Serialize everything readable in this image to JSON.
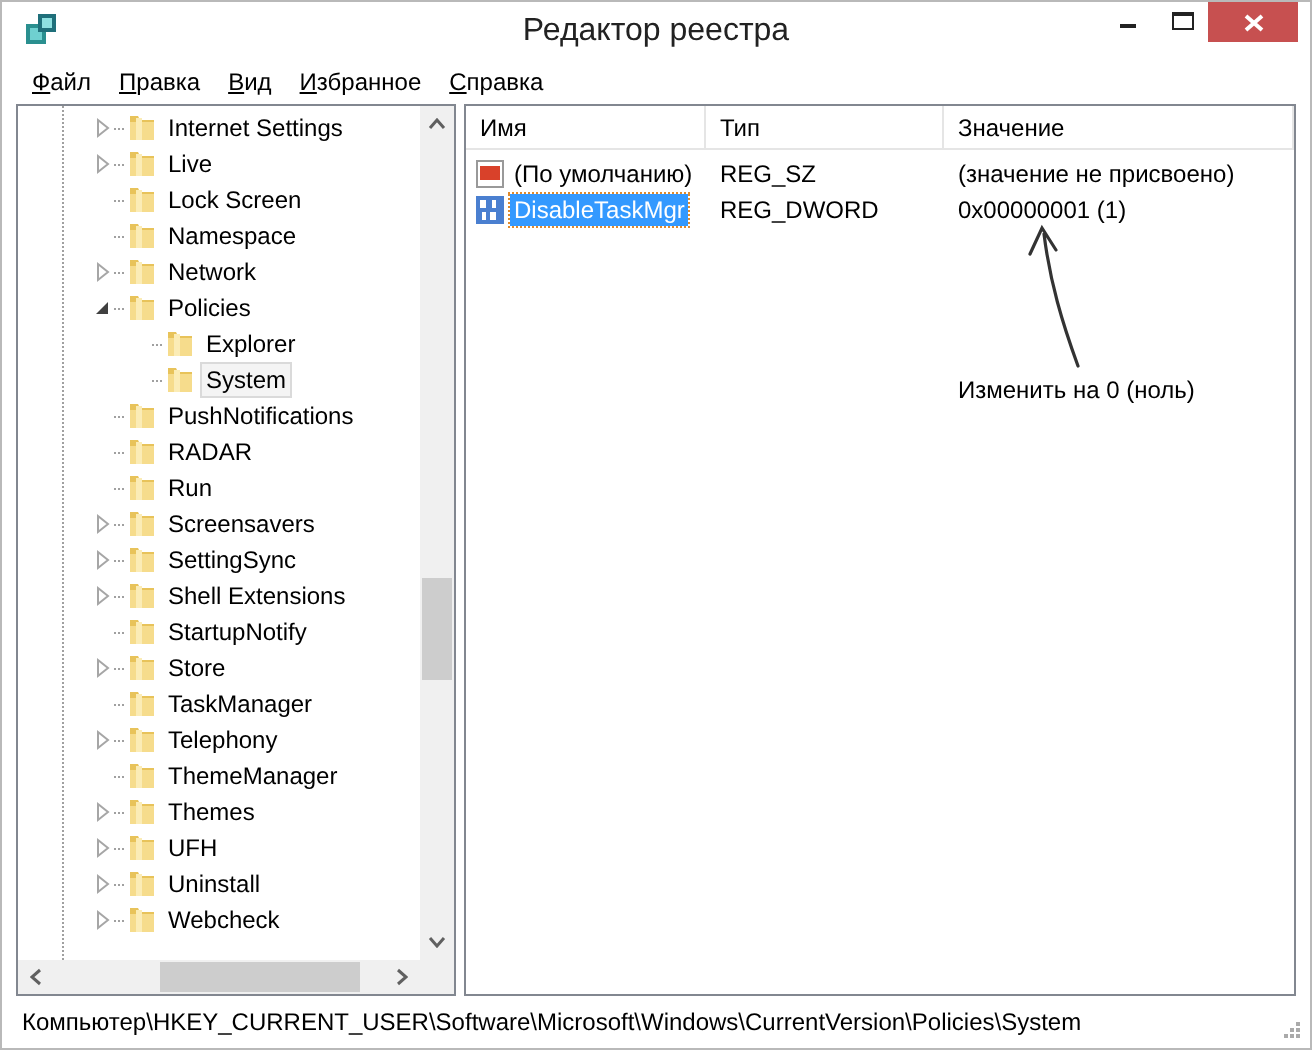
{
  "window": {
    "title": "Редактор реестра"
  },
  "menu": [
    {
      "label": "Файл"
    },
    {
      "label": "Правка"
    },
    {
      "label": "Вид"
    },
    {
      "label": "Избранное"
    },
    {
      "label": "Справка"
    }
  ],
  "tree": {
    "items": [
      {
        "label": "Internet Settings",
        "expandable": true,
        "expanded": false,
        "selected": false
      },
      {
        "label": "Live",
        "expandable": true,
        "expanded": false,
        "selected": false
      },
      {
        "label": "Lock Screen",
        "expandable": false,
        "expanded": false,
        "selected": false
      },
      {
        "label": "Namespace",
        "expandable": false,
        "expanded": false,
        "selected": false
      },
      {
        "label": "Network",
        "expandable": true,
        "expanded": false,
        "selected": false
      },
      {
        "label": "Policies",
        "expandable": true,
        "expanded": true,
        "selected": false,
        "children": [
          {
            "label": "Explorer",
            "expandable": false,
            "expanded": false,
            "selected": false
          },
          {
            "label": "System",
            "expandable": false,
            "expanded": false,
            "selected": true
          }
        ]
      },
      {
        "label": "PushNotifications",
        "expandable": false,
        "expanded": false,
        "selected": false
      },
      {
        "label": "RADAR",
        "expandable": false,
        "expanded": false,
        "selected": false
      },
      {
        "label": "Run",
        "expandable": false,
        "expanded": false,
        "selected": false
      },
      {
        "label": "Screensavers",
        "expandable": true,
        "expanded": false,
        "selected": false
      },
      {
        "label": "SettingSync",
        "expandable": true,
        "expanded": false,
        "selected": false
      },
      {
        "label": "Shell Extensions",
        "expandable": true,
        "expanded": false,
        "selected": false
      },
      {
        "label": "StartupNotify",
        "expandable": false,
        "expanded": false,
        "selected": false
      },
      {
        "label": "Store",
        "expandable": true,
        "expanded": false,
        "selected": false
      },
      {
        "label": "TaskManager",
        "expandable": false,
        "expanded": false,
        "selected": false
      },
      {
        "label": "Telephony",
        "expandable": true,
        "expanded": false,
        "selected": false
      },
      {
        "label": "ThemeManager",
        "expandable": false,
        "expanded": false,
        "selected": false
      },
      {
        "label": "Themes",
        "expandable": true,
        "expanded": false,
        "selected": false
      },
      {
        "label": "UFH",
        "expandable": true,
        "expanded": false,
        "selected": false
      },
      {
        "label": "Uninstall",
        "expandable": true,
        "expanded": false,
        "selected": false
      },
      {
        "label": "Webcheck",
        "expandable": true,
        "expanded": false,
        "selected": false
      }
    ]
  },
  "values": {
    "columns": [
      "Имя",
      "Тип",
      "Значение"
    ],
    "rows": [
      {
        "kind": "string",
        "name": "(По умолчанию)",
        "type": "REG_SZ",
        "value": "(значение не присвоено)",
        "selected": false
      },
      {
        "kind": "dword",
        "name": "DisableTaskMgr",
        "type": "REG_DWORD",
        "value": "0x00000001 (1)",
        "selected": true
      }
    ],
    "annotation": "Изменить на 0 (ноль)"
  },
  "status_bar": "Компьютер\\HKEY_CURRENT_USER\\Software\\Microsoft\\Windows\\CurrentVersion\\Policies\\System"
}
